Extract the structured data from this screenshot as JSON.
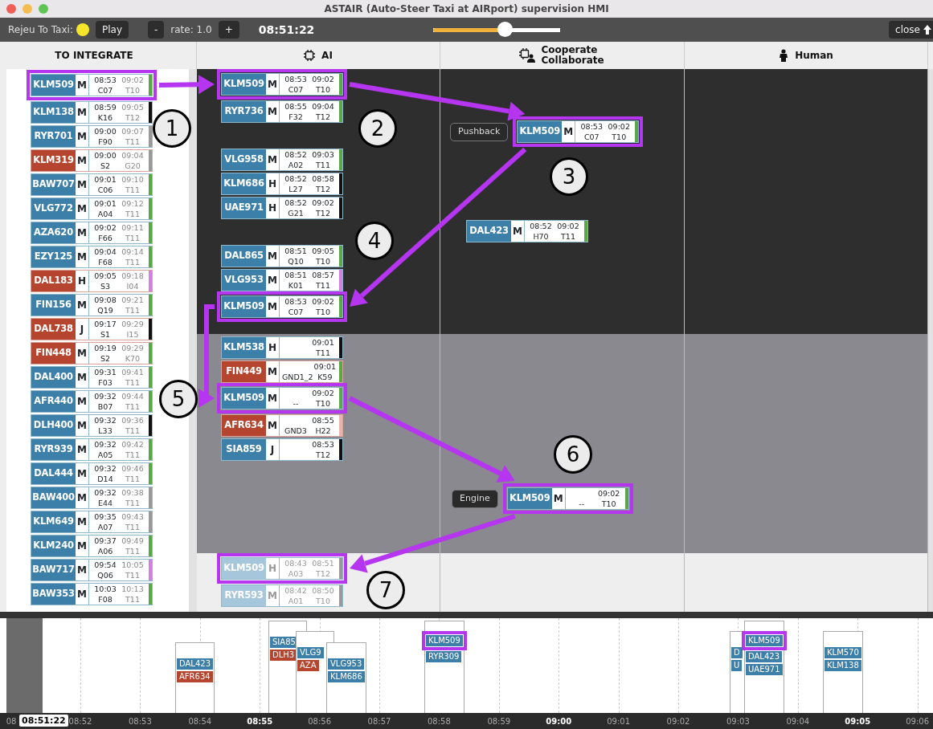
{
  "window": {
    "title": "ASTAIR (Auto-Steer Taxi at AIRport) supervision HMI"
  },
  "toolbar": {
    "label": "Rejeu To Taxi:",
    "indicator": {
      "color": "#f5e52a"
    },
    "play": "Play",
    "minus": "-",
    "rate": "rate: 1.0",
    "plus": "+",
    "clock": "08:51:22",
    "slider": {
      "level": 0.56
    },
    "close": "close"
  },
  "integrate": {
    "title": "TO INTEGRATE",
    "strips": [
      {
        "callsign": "KLM509",
        "color": "#3c7fa8",
        "wake": "M",
        "t1": "08:53",
        "stand": "C07",
        "t2": "09:02",
        "rwy": "T10",
        "status": {
          "color": "#5aa845"
        },
        "step": true
      },
      {
        "callsign": "KLM138",
        "color": "#3c7fa8",
        "wake": "M",
        "t1": "08:59",
        "stand": "K16",
        "t2": "09:05",
        "rwy": "T12",
        "status": {
          "color": "#111111"
        }
      },
      {
        "callsign": "RYR701",
        "color": "#3c7fa8",
        "wake": "M",
        "t1": "09:00",
        "stand": "F90",
        "t2": "09:07",
        "rwy": "T11",
        "status": {
          "color": "#999999"
        }
      },
      {
        "callsign": "KLM319",
        "color": "#b5452f",
        "wake": "M",
        "t1": "09:00",
        "stand": "S2",
        "t2": "09:04",
        "rwy": "G20",
        "status": {
          "color": "#999999"
        }
      },
      {
        "callsign": "BAW707",
        "color": "#3c7fa8",
        "wake": "M",
        "t1": "09:01",
        "stand": "C06",
        "t2": "09:10",
        "rwy": "T11",
        "status": {
          "color": "#5aa845"
        }
      },
      {
        "callsign": "VLG772",
        "color": "#3c7fa8",
        "wake": "M",
        "t1": "09:01",
        "stand": "A04",
        "t2": "09:12",
        "rwy": "T11",
        "status": {
          "color": "#5aa845"
        }
      },
      {
        "callsign": "AZA620",
        "color": "#3c7fa8",
        "wake": "M",
        "t1": "09:02",
        "stand": "F66",
        "t2": "09:11",
        "rwy": "T11",
        "status": {
          "color": "#5aa845"
        }
      },
      {
        "callsign": "EZY125",
        "color": "#3c7fa8",
        "wake": "M",
        "t1": "09:04",
        "stand": "F68",
        "t2": "09:14",
        "rwy": "T11",
        "status": {
          "color": "#5aa845"
        }
      },
      {
        "callsign": "DAL183",
        "color": "#b5452f",
        "wake": "H",
        "t1": "09:05",
        "stand": "S3",
        "t2": "09:18",
        "rwy": "I04",
        "status": {
          "color": "#d27fe0"
        }
      },
      {
        "callsign": "FIN156",
        "color": "#3c7fa8",
        "wake": "M",
        "t1": "09:08",
        "stand": "Q19",
        "t2": "09:21",
        "rwy": "T11",
        "status": {
          "color": "#5aa845"
        }
      },
      {
        "callsign": "DAL738",
        "color": "#b5452f",
        "wake": "J",
        "t1": "09:17",
        "stand": "S1",
        "t2": "09:29",
        "rwy": "I15",
        "status": {
          "color": "#111111"
        }
      },
      {
        "callsign": "FIN448",
        "color": "#b5452f",
        "wake": "M",
        "t1": "09:19",
        "stand": "S2",
        "t2": "09:29",
        "rwy": "K70",
        "status": {
          "color": "#5aa845"
        }
      },
      {
        "callsign": "DAL400",
        "color": "#3c7fa8",
        "wake": "M",
        "t1": "09:31",
        "stand": "F03",
        "t2": "09:41",
        "rwy": "T11",
        "status": {
          "color": "#5aa845"
        }
      },
      {
        "callsign": "AFR440",
        "color": "#3c7fa8",
        "wake": "M",
        "t1": "09:32",
        "stand": "B07",
        "t2": "09:44",
        "rwy": "T11",
        "status": {
          "color": "#5aa845"
        }
      },
      {
        "callsign": "DLH400",
        "color": "#3c7fa8",
        "wake": "M",
        "t1": "09:32",
        "stand": "L33",
        "t2": "09:36",
        "rwy": "T11",
        "status": {
          "color": "#111111"
        }
      },
      {
        "callsign": "RYR939",
        "color": "#3c7fa8",
        "wake": "M",
        "t1": "09:32",
        "stand": "A05",
        "t2": "09:42",
        "rwy": "T11",
        "status": {
          "color": "#5aa845"
        }
      },
      {
        "callsign": "DAL444",
        "color": "#3c7fa8",
        "wake": "M",
        "t1": "09:32",
        "stand": "D14",
        "t2": "09:46",
        "rwy": "T11",
        "status": {
          "color": "#5aa845"
        }
      },
      {
        "callsign": "BAW400",
        "color": "#3c7fa8",
        "wake": "M",
        "t1": "09:32",
        "stand": "E44",
        "t2": "09:38",
        "rwy": "T11",
        "status": {
          "color": "#999999"
        }
      },
      {
        "callsign": "KLM649",
        "color": "#3c7fa8",
        "wake": "M",
        "t1": "09:35",
        "stand": "A07",
        "t2": "09:43",
        "rwy": "T11",
        "status": {
          "color": "#999999"
        }
      },
      {
        "callsign": "KLM240",
        "color": "#3c7fa8",
        "wake": "M",
        "t1": "09:37",
        "stand": "A06",
        "t2": "09:49",
        "rwy": "T11",
        "status": {
          "color": "#5aa845"
        }
      },
      {
        "callsign": "BAW717",
        "color": "#3c7fa8",
        "wake": "M",
        "t1": "09:54",
        "stand": "Q06",
        "t2": "10:05",
        "rwy": "T11",
        "status": {
          "color": "#d27fe0"
        }
      },
      {
        "callsign": "BAW353",
        "color": "#3c7fa8",
        "wake": "M",
        "t1": "10:03",
        "stand": "F08",
        "t2": "10:13",
        "rwy": "T11",
        "status": {
          "color": "#5aa845"
        }
      }
    ]
  },
  "board": {
    "columns": [
      {
        "title": "AI",
        "kind": "chip"
      },
      {
        "title": "Cooperate Collaborate",
        "kind": "chip-person"
      },
      {
        "title": "Human",
        "kind": "person"
      }
    ],
    "bands": [
      {
        "kind": "dark",
        "cells": [
          [
            [
              {
                "callsign": "KLM509",
                "color": "#3c7fa8",
                "wake": "M",
                "t1": "08:53",
                "stand": "C07",
                "t2": "09:02",
                "rwy": "T10",
                "status": {
                  "color": "#5aa845"
                },
                "step": true
              },
              {
                "callsign": "RYR736",
                "color": "#3c7fa8",
                "wake": "M",
                "t1": "08:55",
                "stand": "F32",
                "t2": "09:04",
                "rwy": "T12",
                "status": {
                  "color": "#5aa845"
                }
              }
            ],
            [
              {
                "callsign": "VLG958",
                "color": "#3c7fa8",
                "wake": "M",
                "t1": "08:52",
                "stand": "A02",
                "t2": "09:03",
                "rwy": "T11",
                "status": {
                  "color": "#5aa845"
                }
              },
              {
                "callsign": "KLM686",
                "color": "#3c7fa8",
                "wake": "H",
                "t1": "08:52",
                "stand": "L27",
                "t2": "08:58",
                "rwy": "T12",
                "status": {
                  "color": "#111111"
                }
              },
              {
                "callsign": "UAE971",
                "color": "#3c7fa8",
                "wake": "H",
                "t1": "08:52",
                "stand": "G21",
                "t2": "09:02",
                "rwy": "T12",
                "status": {
                  "color": "#111111"
                }
              }
            ],
            [
              {
                "callsign": "DAL865",
                "color": "#3c7fa8",
                "wake": "M",
                "t1": "08:51",
                "stand": "Q10",
                "t2": "09:05",
                "rwy": "T10",
                "status": {
                  "color": "#5aa845"
                }
              },
              {
                "callsign": "VLG953",
                "color": "#3c7fa8",
                "wake": "M",
                "t1": "08:51",
                "stand": "K01",
                "t2": "08:57",
                "rwy": "T11",
                "status": {
                  "color": "#d27fe0"
                }
              },
              {
                "callsign": "KLM509",
                "color": "#3c7fa8",
                "wake": "M",
                "t1": "08:53",
                "stand": "C07",
                "t2": "09:02",
                "rwy": "T10",
                "status": {
                  "color": "#5aa845"
                },
                "step": true
              }
            ]
          ],
          [
            [
              {
                "tag": "Pushback",
                "callsign": "KLM509",
                "color": "#3c7fa8",
                "wake": "M",
                "t1": "08:53",
                "stand": "C07",
                "t2": "09:02",
                "rwy": "T10",
                "status": {
                  "color": "#5aa845"
                },
                "step": true
              }
            ],
            [
              {
                "callsign": "DAL423",
                "color": "#3c7fa8",
                "wake": "M",
                "t1": "08:52",
                "stand": "H70",
                "t2": "09:02",
                "rwy": "T11",
                "status": {
                  "color": "#5aa845"
                }
              }
            ]
          ],
          []
        ]
      },
      {
        "kind": "grey",
        "cells": [
          [
            [
              {
                "callsign": "KLM538",
                "color": "#3c7fa8",
                "wake": "H",
                "t2": "09:01",
                "rwy": "T11",
                "status": {
                  "color": "#111111"
                }
              },
              {
                "callsign": "FIN449",
                "color": "#b5452f",
                "wake": "M",
                "stand": "GND1_2",
                "t2": "09:01",
                "rwy": "K59",
                "status": {
                  "color": "#5aa845"
                }
              },
              {
                "callsign": "KLM509",
                "color": "#3c7fa8",
                "wake": "M",
                "stand": "--",
                "t2": "09:02",
                "rwy": "T10",
                "status": {
                  "color": "#5aa845"
                },
                "step": true
              },
              {
                "callsign": "AFR634",
                "color": "#b5452f",
                "wake": "M",
                "stand": "GND3",
                "t2": "08:55",
                "rwy": "H22",
                "status": {
                  "color": "#e8b4b0"
                }
              },
              {
                "callsign": "SIA859",
                "color": "#3c7fa8",
                "wake": "J",
                "t2": "08:53",
                "rwy": "T12",
                "status": {
                  "color": "#111111"
                }
              }
            ]
          ],
          [
            [
              {
                "tag": "Engine",
                "callsign": "KLM509",
                "color": "#3c7fa8",
                "wake": "M",
                "stand": "--",
                "t2": "09:02",
                "rwy": "T10",
                "status": {
                  "color": "#5aa845"
                },
                "step": true
              }
            ]
          ],
          []
        ]
      },
      {
        "kind": "light",
        "cells": [
          [
            [
              {
                "callsign": "KLM509",
                "color": "#a6c7db",
                "wake": "H",
                "t1": "08:43",
                "stand": "A03",
                "t2": "08:51",
                "rwy": "T12",
                "status": {
                  "color": "#999999"
                },
                "faded": true,
                "step": true
              },
              {
                "callsign": "RYR593",
                "color": "#a6c7db",
                "wake": "M",
                "t1": "08:42",
                "stand": "A01",
                "t2": "08:50",
                "rwy": "T10",
                "status": {
                  "color": "#999999"
                },
                "faded": true
              }
            ]
          ],
          [],
          []
        ]
      }
    ]
  },
  "annotations": [
    {
      "label": "1"
    },
    {
      "label": "2"
    },
    {
      "label": "3"
    },
    {
      "label": "4"
    },
    {
      "label": "5"
    },
    {
      "label": "6"
    },
    {
      "label": "7"
    }
  ],
  "timeline": {
    "now": "08:51:22",
    "ticks": [
      {
        "label": "08",
        "bold": false
      },
      {
        "label": "08:52",
        "bold": false
      },
      {
        "label": "08:53",
        "bold": false
      },
      {
        "label": "08:54",
        "bold": false
      },
      {
        "label": "08:55",
        "bold": true
      },
      {
        "label": "08:56",
        "bold": false
      },
      {
        "label": "08:57",
        "bold": false
      },
      {
        "label": "08:58",
        "bold": false
      },
      {
        "label": "08:59",
        "bold": false
      },
      {
        "label": "09:00",
        "bold": true
      },
      {
        "label": "09:01",
        "bold": false
      },
      {
        "label": "09:02",
        "bold": false
      },
      {
        "label": "09:03",
        "bold": false
      },
      {
        "label": "09:04",
        "bold": false
      },
      {
        "label": "09:05",
        "bold": true
      },
      {
        "label": "09:06",
        "bold": false
      }
    ],
    "groups": [
      [
        {
          "callsign": "DAL423",
          "color": "#3c7fa8"
        },
        {
          "callsign": "AFR634",
          "color": "#b5452f"
        }
      ],
      [
        {
          "callsign": "SIA85",
          "color": "#3c7fa8"
        },
        {
          "callsign": "DLH3",
          "color": "#b5452f"
        }
      ],
      [
        {
          "callsign": "VLG9",
          "color": "#3c7fa8"
        },
        {
          "callsign": "AZA",
          "color": "#b5452f"
        }
      ],
      [
        {
          "callsign": "VLG953",
          "color": "#3c7fa8"
        },
        {
          "callsign": "KLM686",
          "color": "#3c7fa8"
        }
      ],
      [
        {
          "callsign": "KLM509",
          "color": "#3c7fa8",
          "highlighted": true
        },
        {
          "callsign": "RYR309",
          "color": "#3c7fa8"
        }
      ],
      [
        {
          "callsign": "D",
          "color": "#3c7fa8"
        },
        {
          "callsign": "U",
          "color": "#3c7fa8"
        }
      ],
      [
        {
          "callsign": "KLM509",
          "color": "#3c7fa8",
          "highlighted": true
        },
        {
          "callsign": "DAL423",
          "color": "#3c7fa8"
        },
        {
          "callsign": "UAE971",
          "color": "#3c7fa8"
        }
      ],
      [
        {
          "callsign": "KLM570",
          "color": "#3c7fa8"
        },
        {
          "callsign": "KLM138",
          "color": "#3c7fa8"
        }
      ]
    ]
  }
}
